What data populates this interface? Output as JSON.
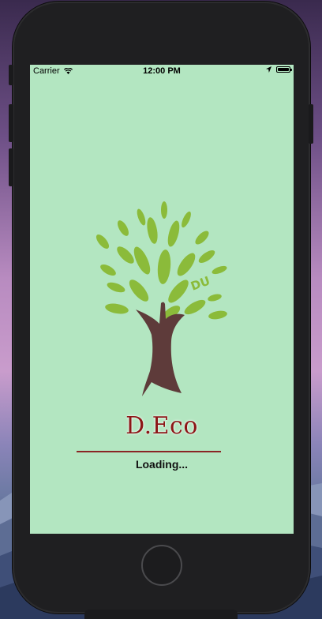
{
  "status_bar": {
    "carrier": "Carrier",
    "time": "12:00 PM",
    "wifi_icon": "wifi-icon",
    "location_icon": "location-arrow-icon",
    "battery_icon": "battery-icon",
    "battery_level": 1.0
  },
  "splash": {
    "logo_badge": "DU",
    "app_name": "D.Eco",
    "loading_text": "Loading...",
    "logo_icon": "tree-logo",
    "colors": {
      "background": "#b3e6c1",
      "leaf": "#8bbb3a",
      "trunk": "#5e3b3a",
      "title": "#8b1616",
      "divider": "#8a2424"
    }
  },
  "device": {
    "home_button_icon": "home-button"
  }
}
